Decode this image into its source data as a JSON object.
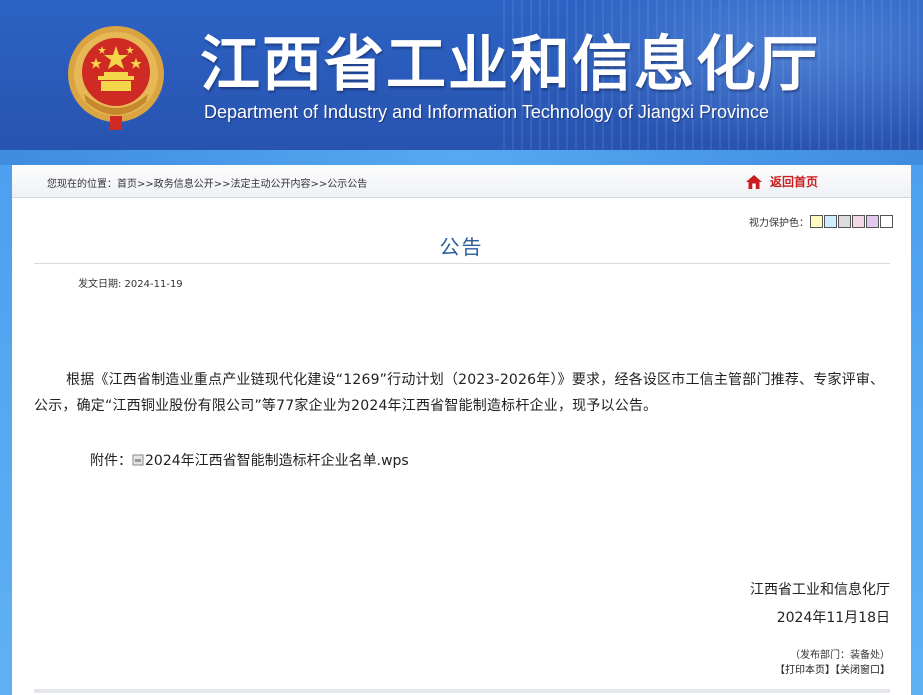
{
  "header": {
    "title_cn": "江西省工业和信息化厅",
    "title_en": "Department of Industry and Information Technology of Jiangxi Province"
  },
  "breadcrumb": {
    "prefix": "您现在的位置：",
    "items": [
      "首页",
      "政务信息公开",
      "法定主动公开内容",
      "公示公告"
    ],
    "separator": ">>"
  },
  "home_link": "返回首页",
  "eyecare": {
    "label": "视力保护色：",
    "colors": [
      "#fffbc0",
      "#cfeefd",
      "#dcdcdc",
      "#f3d9e8",
      "#e3c8f2",
      "#ffffff"
    ]
  },
  "notice": {
    "title": "公告",
    "date": "发文日期: 2024-11-19",
    "body": "根据《江西省制造业重点产业链现代化建设“1269”行动计划（2023-2026年）》要求，经各设区市工信主管部门推荐、专家评审、公示，确定“江西铜业股份有限公司”等77家企业为2024年江西省智能制造标杆企业，现予以公告。",
    "attachment_label": "附件：",
    "attachment_file": "2024年江西省智能制造标杆企业名单.wps",
    "sign_org": "江西省工业和信息化厅",
    "sign_date": "2024年11月18日",
    "publisher": "（发布部门：装备处）",
    "print_label": "【打印本页】",
    "close_label": "【关闭窗口】"
  },
  "colors": {
    "banner": "#2a59b8",
    "title_blue": "#2a5d9c",
    "home_red": "#c81e1e"
  }
}
